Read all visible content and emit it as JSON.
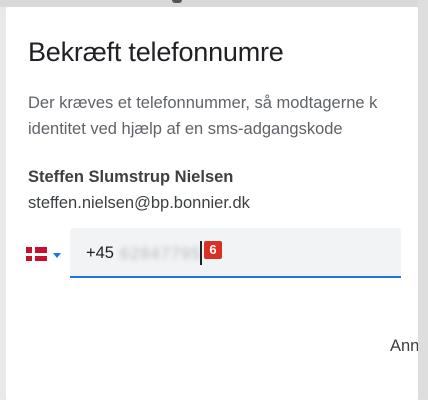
{
  "dialog": {
    "title": "Bekræft telefonnumre",
    "description_line1": "Der kræves et telefonnummer, så modtagerne k",
    "description_line2": "identitet ved hjælp af en sms-adgangskode"
  },
  "recipient": {
    "name": "Steffen Slumstrup Nielsen",
    "email": "steffen.nielsen@bp.bonnier.dk"
  },
  "phone": {
    "country_flag": "denmark-flag-icon",
    "prefix": "+45",
    "blurred_number": "62847795",
    "step_badge": "6"
  },
  "actions": {
    "cancel_label": "Ann"
  },
  "colors": {
    "accent": "#1a73e8",
    "badge": "#d93025",
    "field_bg": "#f1f3f4"
  }
}
